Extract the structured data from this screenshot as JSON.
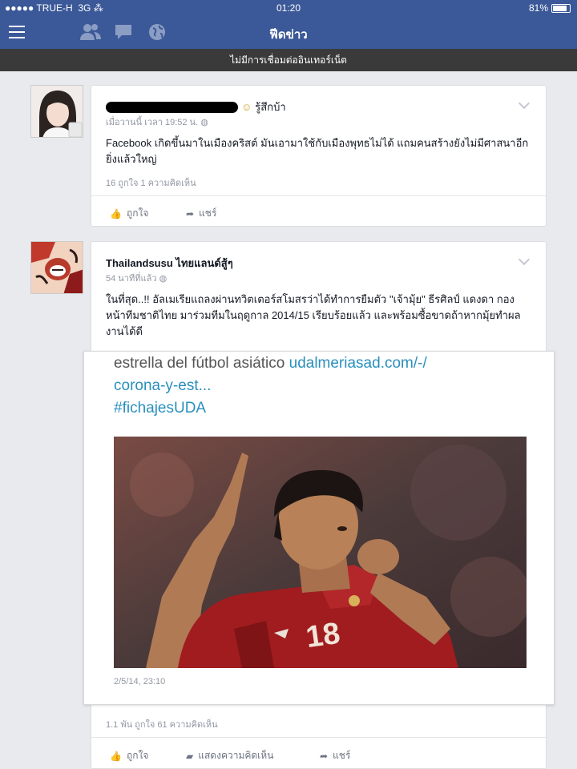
{
  "status_bar": {
    "carrier": "●●●●● TRUE-H",
    "network": "3G",
    "time": "01:20",
    "battery": "81%"
  },
  "nav": {
    "title": "ฟีดข่าว",
    "icons": [
      "menu-icon",
      "friends-icon",
      "messages-icon",
      "globe-icon"
    ]
  },
  "offline_banner": "ไม่มีการเชื่อมต่ออินเทอร์เน็ต",
  "posts": [
    {
      "name_suffix": "รู้สึกบ้า",
      "time": "เมื่อวานนี้ เวลา 19:52 น.",
      "text": "Facebook เกิดขึ้นมาในเมืองคริสต์ มันเอามาใช้กับเมืองพุทธไม่ได้ แถมคนสร้างยังไม่มีศาสนาอีก ยิ่งแล้วใหญ่",
      "counts": "16 ถูกใจ  1 ความคิดเห็น",
      "like_label": "ถูกใจ",
      "share_label": "แชร์"
    },
    {
      "name": "Thailandsusu ไทยแลนด์สู้ๆ",
      "time": "54 นาทีที่แล้ว",
      "text": "ในที่สุด..!! อัลเมเรียแถลงผ่านทวิตเตอร์สโมสรว่าได้ทำการยืมตัว \"เจ้ามุ้ย\" ธีรศิลป์ แดงดา กองหน้าทีมชาติไทย มาร่วมทีมในฤดูกาล 2014/15 เรียบร้อยแล้ว และพร้อมซื้อขาดถ้าหากมุ้ยทำผลงานได้ดี",
      "shared": {
        "line1_text": "estrella del fútbol asiático ",
        "line1_link": "udalmeriasad.com/-/",
        "line2": "corona-y-est...",
        "line3": "#fichajesUDA",
        "jersey_number": "18",
        "timestamp": "2/5/14, 23:10"
      },
      "counts": "1.1 พัน ถูกใจ  61 ความคิดเห็น",
      "like_label": "ถูกใจ",
      "comment_label": "แสดงความคิดเห็น",
      "share_label": "แชร์"
    }
  ],
  "colors": {
    "brand": "#3b5998",
    "background": "#e9eaed",
    "link": "#2a8fbd"
  }
}
